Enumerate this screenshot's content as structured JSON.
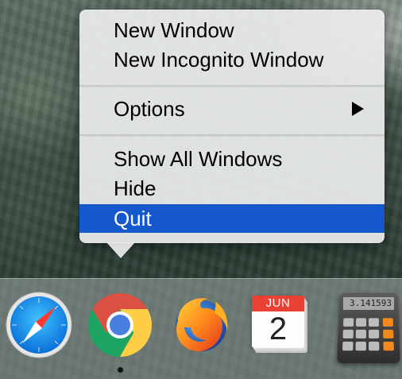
{
  "context_menu": {
    "items": [
      {
        "label": "New Window"
      },
      {
        "label": "New Incognito Window"
      },
      {
        "label": "Options",
        "has_submenu": true
      },
      {
        "label": "Show All Windows"
      },
      {
        "label": "Hide"
      },
      {
        "label": "Quit",
        "selected": true
      }
    ]
  },
  "dock": {
    "apps": [
      {
        "icon": "safari-icon"
      },
      {
        "icon": "chrome-icon",
        "running": true
      },
      {
        "icon": "firefox-icon"
      },
      {
        "icon": "calendar-icon",
        "month": "JUN",
        "day": "2"
      },
      {
        "icon": "calculator-icon",
        "display": "3.141593"
      }
    ]
  },
  "colors": {
    "selection": "#1558cc",
    "calendar_red": "#e84237",
    "calculator_orange": "#f08a1e"
  }
}
